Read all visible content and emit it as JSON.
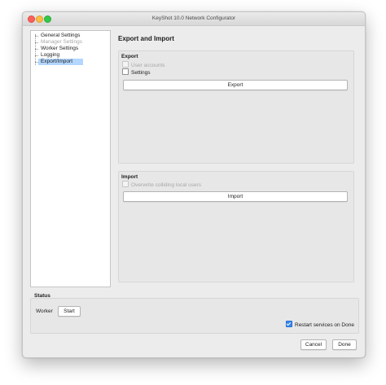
{
  "window": {
    "title": "KeyShot 10.0 Network Configurator"
  },
  "sidebar": {
    "items": [
      {
        "label": "General Settings",
        "state": "normal"
      },
      {
        "label": "Manager Settings",
        "state": "disabled"
      },
      {
        "label": "Worker Settings",
        "state": "normal"
      },
      {
        "label": "Logging",
        "state": "normal"
      },
      {
        "label": "Export/Import",
        "state": "selected"
      }
    ]
  },
  "main": {
    "heading": "Export and Import",
    "export": {
      "title": "Export",
      "user_accounts": {
        "label": "User accounts",
        "checked": false,
        "enabled": false
      },
      "settings": {
        "label": "Settings",
        "checked": false,
        "enabled": true
      },
      "button": "Export"
    },
    "import": {
      "title": "Import",
      "overwrite": {
        "label": "Overwrite colliding local users",
        "checked": false,
        "enabled": false
      },
      "button": "Import"
    }
  },
  "status": {
    "title": "Status",
    "worker_label": "Worker",
    "start_button": "Start",
    "restart": {
      "label": "Restart services on Done",
      "checked": true
    }
  },
  "footer": {
    "cancel": "Cancel",
    "done": "Done"
  },
  "colors": {
    "selection": "#b3d7ff",
    "accent": "#3b86e8"
  }
}
